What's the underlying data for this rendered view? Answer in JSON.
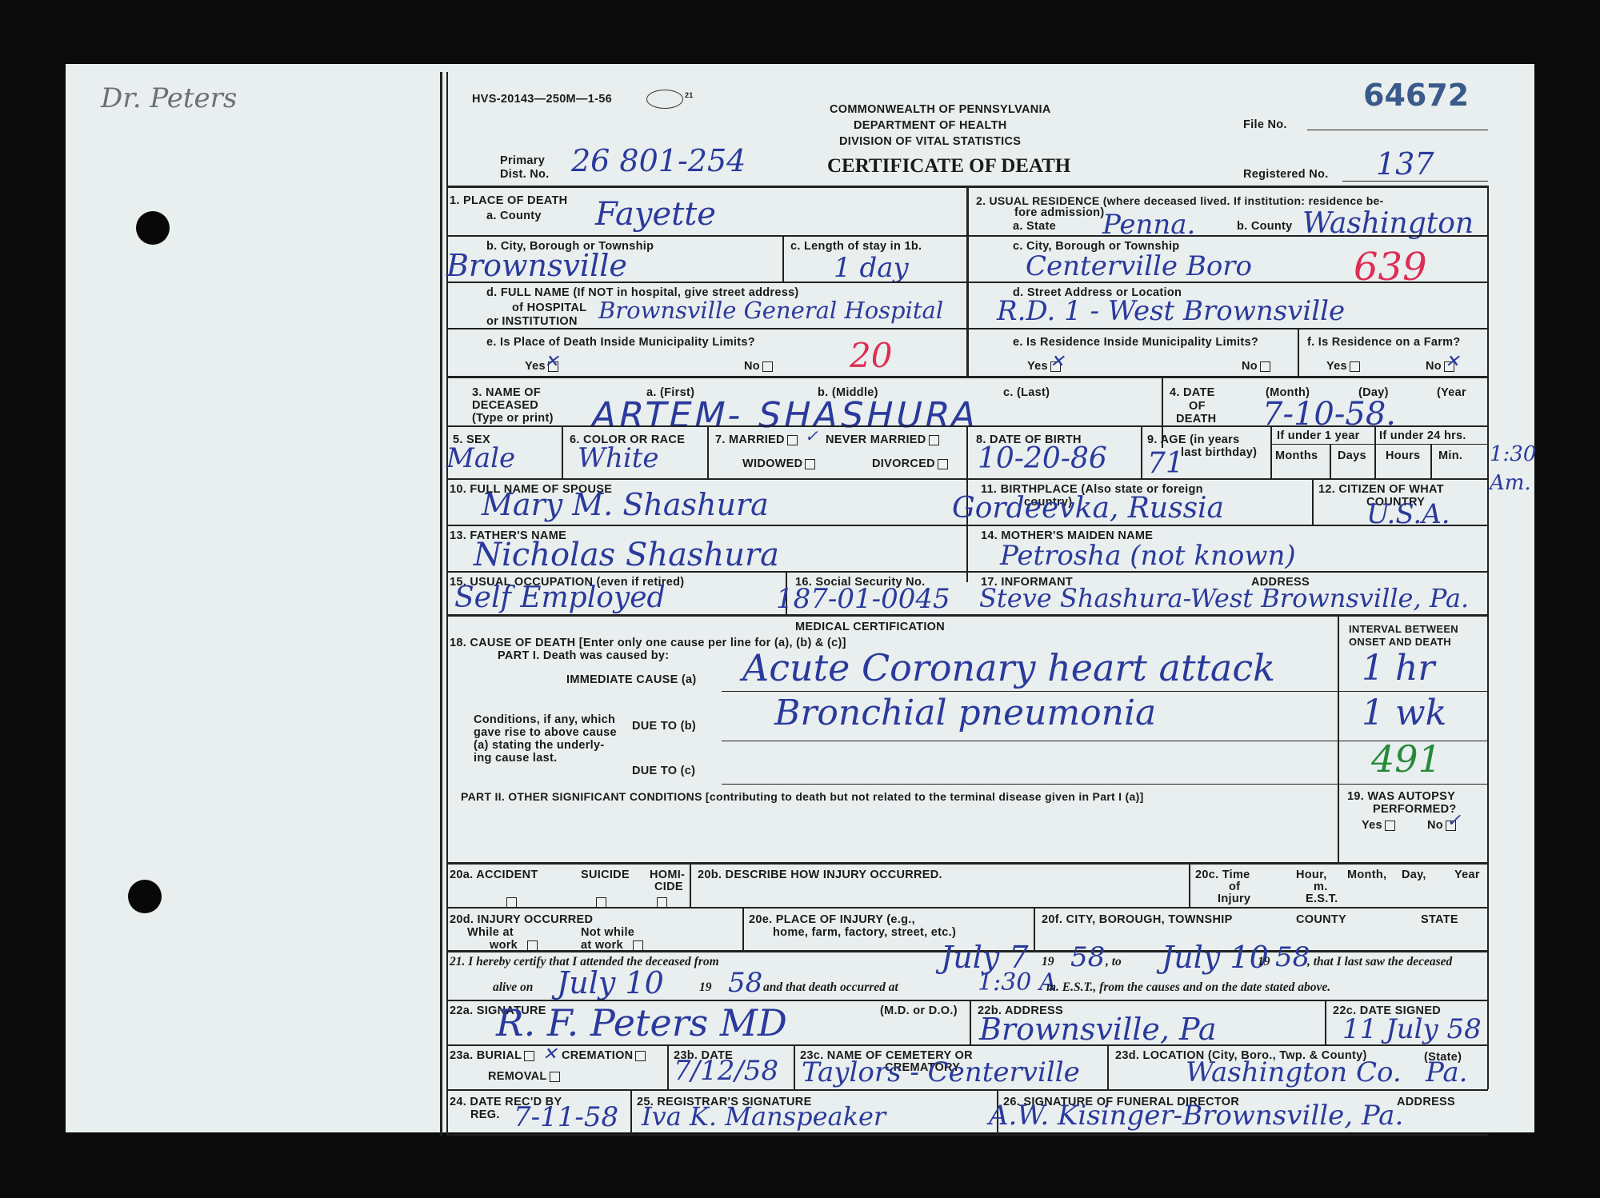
{
  "margin_note": "Dr. Peters",
  "header": {
    "form_code": "HVS-20143—250M—1-56",
    "form_code_suffix": "21",
    "commonwealth": "COMMONWEALTH OF PENNSYLVANIA",
    "department": "DEPARTMENT OF HEALTH",
    "division": "DIVISION OF VITAL STATISTICS",
    "title": "CERTIFICATE OF DEATH",
    "file_no_label": "File No.",
    "file_no": "64672",
    "primary_label_1": "Primary",
    "primary_label_2": "Dist. No.",
    "primary_dist_no": "26 801-254",
    "registered_label": "Registered No.",
    "registered_no": "137"
  },
  "place_of_death": {
    "section_label": "1. PLACE OF DEATH",
    "county_label": "a. County",
    "county": "Fayette",
    "city_label": "b. City, Borough or Township",
    "city": "Brownsville",
    "stay_label": "c. Length of stay in 1b.",
    "stay": "1 day",
    "hospital_label_1": "d. FULL NAME (If NOT in hospital, give street address)",
    "hospital_label_2": "of HOSPITAL",
    "hospital_label_3": "or INSTITUTION",
    "hospital": "Brownsville General Hospital",
    "limits_label": "e. Is Place of Death Inside Municipality Limits?",
    "yes_label": "Yes",
    "no_label": "No",
    "code": "20"
  },
  "usual_residence": {
    "section_label": "2. USUAL RESIDENCE (where deceased lived.  If institution: residence be-",
    "section_label_2": "fore admission)",
    "state_label": "a. State",
    "state": "Penna.",
    "county_label": "b. County",
    "county": "Washington",
    "city_label": "c. City, Borough or Township",
    "city": "Centerville Boro",
    "code": "639",
    "street_label": "d. Street Address or Location",
    "street": "R.D. 1 - West Brownsville",
    "limits_label": "e. Is Residence Inside Municipality Limits?",
    "farm_label": "f. Is Residence on a Farm?",
    "yes_label": "Yes",
    "no_label": "No"
  },
  "deceased": {
    "name_label_1": "3. NAME OF",
    "name_label_2": "DECEASED",
    "name_label_3": "(Type or print)",
    "first_label": "a. (First)",
    "middle_label": "b. (Middle)",
    "last_label": "c. (Last)",
    "name": "ARTEM-   SHASHURA",
    "date_label_1": "4. DATE",
    "date_label_2": "OF",
    "date_label_3": "DEATH",
    "month_label": "(Month)",
    "day_label": "(Day)",
    "year_label": "(Year",
    "date_of_death": "7-10-58.",
    "sex_label": "5. SEX",
    "sex": "Male",
    "color_label": "6. COLOR OR RACE",
    "color": "White",
    "married_label": "7. MARRIED",
    "never_married_label": "NEVER MARRIED",
    "widowed_label": "WIDOWED",
    "divorced_label": "DIVORCED",
    "birth_label": "8. DATE OF BIRTH",
    "birth": "10-20-86",
    "age_label_1": "9. AGE (in years",
    "age_label_2": "last birthday)",
    "age": "71",
    "under_year_label": "If under 1 year",
    "under_day_label": "If under 24 hrs.",
    "months_label": "Months",
    "days_label": "Days",
    "hours_label": "Hours",
    "min_label": "Min.",
    "time_note": "1:30 Am.",
    "spouse_label": "10. FULL NAME OF SPOUSE",
    "spouse": "Mary M. Shashura",
    "birthplace_label": "11. BIRTHPLACE (Also state or foreign",
    "birthplace_label_2": "country)",
    "birthplace": "Gordeevka, Russia",
    "citizen_label": "12. CITIZEN OF WHAT",
    "citizen_label_2": "COUNTRY",
    "citizen": "U.S.A.",
    "father_label": "13. FATHER'S NAME",
    "father": "Nicholas Shashura",
    "mother_label": "14. MOTHER'S MAIDEN NAME",
    "mother": "Petrosha (not known)",
    "occupation_label": "15. USUAL OCCUPATION (even if retired)",
    "occupation": "Self Employed",
    "ssn_label": "16. Social Security No.",
    "ssn": "187-01-0045",
    "informant_label": "17. INFORMANT",
    "address_label": "ADDRESS",
    "informant": "Steve Shashura-West Brownsville, Pa."
  },
  "medical": {
    "title": "MEDICAL CERTIFICATION",
    "cause_label": "18. CAUSE OF DEATH [Enter only one cause per line for (a), (b) & (c)]",
    "part1_label": "PART I. Death was caused by:",
    "immediate_label": "IMMEDIATE CAUSE  (a)",
    "immediate": "Acute Coronary heart attack",
    "interval_label_1": "INTERVAL BETWEEN",
    "interval_label_2": "ONSET AND DEATH",
    "interval_a": "1 hr",
    "conditions_1": "Conditions, if any, which",
    "conditions_2": "gave rise to above cause",
    "conditions_3": "(a) stating the underly-",
    "conditions_4": "ing cause last.",
    "due_b_label": "DUE TO  (b)",
    "due_b": "Bronchial pneumonia",
    "interval_b": "1 wk",
    "due_c_label": "DUE TO  (c)",
    "code_c": "491",
    "part2_label": "PART II. OTHER SIGNIFICANT CONDITIONS [contributing to death but not related to the terminal disease given in Part I (a)]",
    "autopsy_label_1": "19. WAS AUTOPSY",
    "autopsy_label_2": "PERFORMED?",
    "yes_label": "Yes",
    "no_label": "No"
  },
  "injury": {
    "accident_label": "20a. ACCIDENT",
    "suicide_label": "SUICIDE",
    "homicide_label_1": "HOMI-",
    "homicide_label_2": "CIDE",
    "describe_label": "20b. DESCRIBE HOW INJURY OCCURRED.",
    "time_label": "20c. Time",
    "of_label": "of",
    "injury_label": "Injury",
    "hour_label": "Hour,",
    "m_label": "m.",
    "est_label": "E.S.T.",
    "month_label": "Month,",
    "day_label": "Day,",
    "year_label": "Year",
    "occurred_label": "20d. INJURY OCCURRED",
    "while_label_1": "While at",
    "while_label_2": "work",
    "not_while_label_1": "Not while",
    "not_while_label_2": "at work",
    "place_label_1": "20e. PLACE OF INJURY (e.g.,",
    "place_label_2": "home, farm, factory, street, etc.)",
    "city_label": "20f. CITY, BOROUGH, TOWNSHIP",
    "county_label": "COUNTY",
    "state_label": "STATE"
  },
  "certification": {
    "line1_a": "21. I hereby certify that I attended the deceased from",
    "from": "July 7",
    "from_year": "58",
    "line1_b": "19",
    "line1_c": ", to",
    "to": "July 10",
    "to_year": "58",
    "line1_d": ", that I last saw the deceased",
    "line2_a": "alive on",
    "alive_on": "July 10",
    "alive_year": "58",
    "line2_b": "and that death occurred at",
    "death_time": "1:30 A",
    "line2_c": "m. E.S.T., from the causes and on the date stated above.",
    "signature_label": "22a. SIGNATURE",
    "md_label": "(M.D. or D.O.)",
    "signature": "R. F. Peters MD",
    "address_label": "22b. ADDRESS",
    "address": "Brownsville, Pa",
    "date_signed_label": "22c. DATE SIGNED",
    "date_signed": "11 July 58"
  },
  "burial": {
    "burial_label": "23a. BURIAL",
    "cremation_label": "CREMATION",
    "removal_label": "REMOVAL",
    "date_label": "23b. DATE",
    "date": "7/12/58",
    "cemetery_label_1": "23c. NAME OF CEMETERY OR",
    "cemetery_label_2": "CREMATORY",
    "cemetery": "Taylors - Centerville",
    "location_label": "23d. LOCATION (City, Boro., Twp. & County)",
    "state_label": "(State)",
    "location": "Washington Co.",
    "location_state": "Pa.",
    "rec_label_1": "24. DATE REC'D BY",
    "rec_label_2": "REG.",
    "rec_date": "7-11-58",
    "registrar_label": "25. REGISTRAR'S SIGNATURE",
    "registrar": "Iva K. Manspeaker",
    "funeral_label": "26. SIGNATURE OF FUNERAL DIRECTOR",
    "funeral_address_label": "ADDRESS",
    "funeral": "A.W. Kisinger-Brownsville, Pa."
  },
  "colors": {
    "ink": "#2a3a9c",
    "red_ink": "#dd2e55",
    "green_ink": "#258a3a",
    "paper": "#e9eeee",
    "number": "#3a5a8c"
  }
}
